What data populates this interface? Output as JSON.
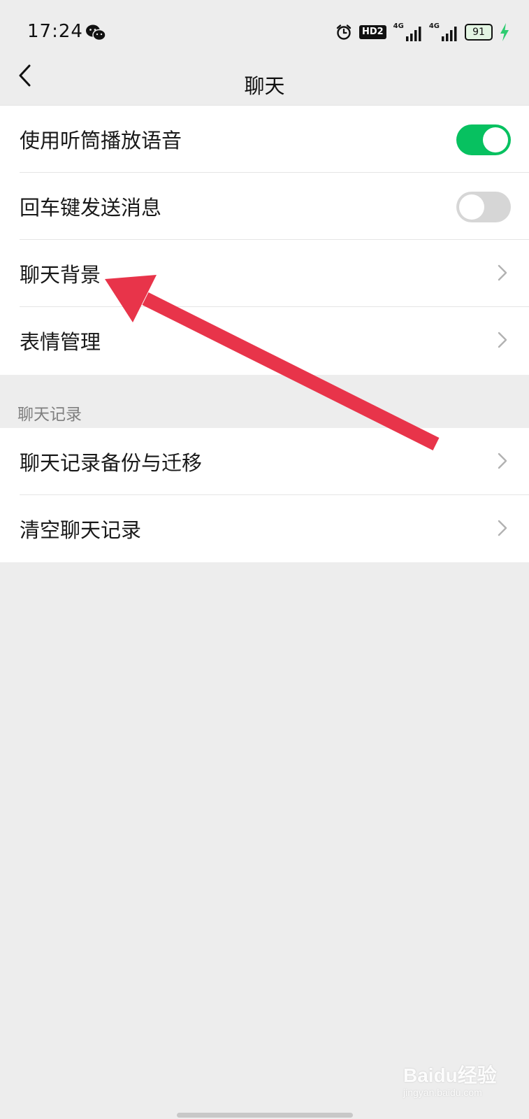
{
  "status_bar": {
    "time": "17:24",
    "hd_label": "HD2",
    "network_1": "4G",
    "network_2": "4G",
    "battery_percent": "91",
    "icons": [
      "wechat-icon",
      "alarm-icon",
      "hd-icon",
      "signal-icon",
      "signal-icon",
      "battery-icon",
      "charging-icon"
    ]
  },
  "nav": {
    "title": "聊天",
    "back_icon": "chevron-left-icon"
  },
  "group1": {
    "items": [
      {
        "label": "使用听筒播放语音",
        "type": "toggle",
        "on": true
      },
      {
        "label": "回车键发送消息",
        "type": "toggle",
        "on": false
      },
      {
        "label": "聊天背景",
        "type": "link"
      },
      {
        "label": "表情管理",
        "type": "link"
      }
    ]
  },
  "section2": {
    "header": "聊天记录",
    "items": [
      {
        "label": "聊天记录备份与迁移",
        "type": "link"
      },
      {
        "label": "清空聊天记录",
        "type": "link"
      }
    ]
  },
  "watermark": {
    "brand": "Baidu经验",
    "url": "jingyan.baidu.com"
  },
  "colors": {
    "accent_green": "#07c160",
    "toggle_off": "#d6d6d6",
    "annotation_arrow": "#e8344a",
    "background": "#ededed"
  }
}
